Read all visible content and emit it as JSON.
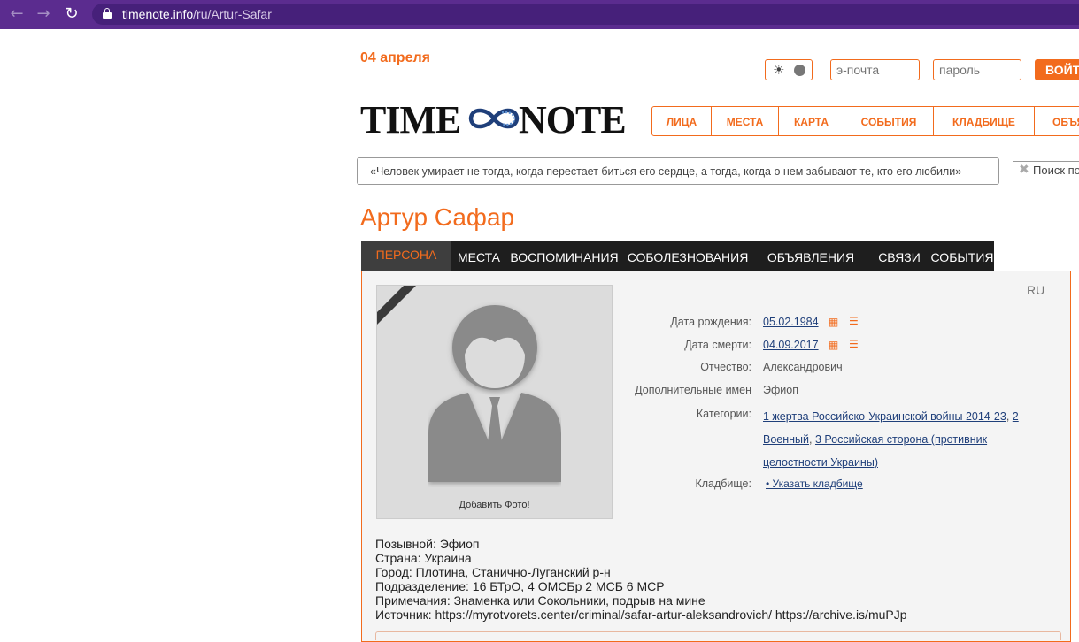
{
  "browser": {
    "back_icon": "←",
    "forward_icon": "→",
    "reload_icon": "↻",
    "url_host": "timenote.info",
    "url_path": "/ru/Artur-Safar"
  },
  "header": {
    "date": "04 апреля",
    "email_placeholder": "э-почта",
    "password_placeholder": "пароль",
    "login_label": "ВОЙТИ",
    "logo_left": "TIME",
    "logo_right": "NOTE",
    "nav": [
      "ЛИЦА",
      "МЕСТА",
      "КАРТА",
      "СОБЫТИЯ",
      "КЛАДБИЩЕ",
      "ОБЪЯВЛЕНИЯ"
    ],
    "quote": "«Человек умирает не тогда, когда перестает биться его сердце, а тогда, когда о нем забывают те, кто его любили»",
    "search_placeholder": "Поиск по имени",
    "accent_color": "#f26b1d"
  },
  "person": {
    "name": "Артур Сафар",
    "tabs": [
      "ПЕРСОНА",
      "МЕСТА",
      "ВОСПОМИНАНИЯ",
      "СОБОЛЕЗНОВАНИЯ",
      "ОБЪЯВЛЕНИЯ",
      "СВЯЗИ",
      "СОБЫТИЯ"
    ],
    "lang": "RU",
    "add_photo": "Добавить Фото!",
    "birth_label": "Дата рождения:",
    "birth_value": "05.02.1984",
    "death_label": "Дата смерти:",
    "death_value": "04.09.2017",
    "patronymic_label": "Отчество:",
    "patronymic_value": "Александрович",
    "other_names_label": "Дополнительные имен",
    "other_names_value": "Эфиоп",
    "categories_label": "Категории:",
    "categories": [
      "1 жертва Российско-Украинской войны 2014-23",
      "2 Военный",
      "3 Российская сторона (противник целостности Украины)"
    ],
    "cemetery_label": "Кладбище:",
    "cemetery_value": "• Указать кладбище",
    "bio": [
      "Позывной: Эфиоп",
      "Страна: Украина",
      "Город: Плотина, Станично-Луганский р-н",
      "Подразделение: 16 БТрО, 4 ОМСБр 2 МСБ 6 МСР",
      "Примечания: Знаменка или Сокольники, подрыв на мине",
      "Источник: https://myrotvorets.center/criminal/safar-artur-aleksandrovich/ https://archive.is/muPJp"
    ]
  }
}
